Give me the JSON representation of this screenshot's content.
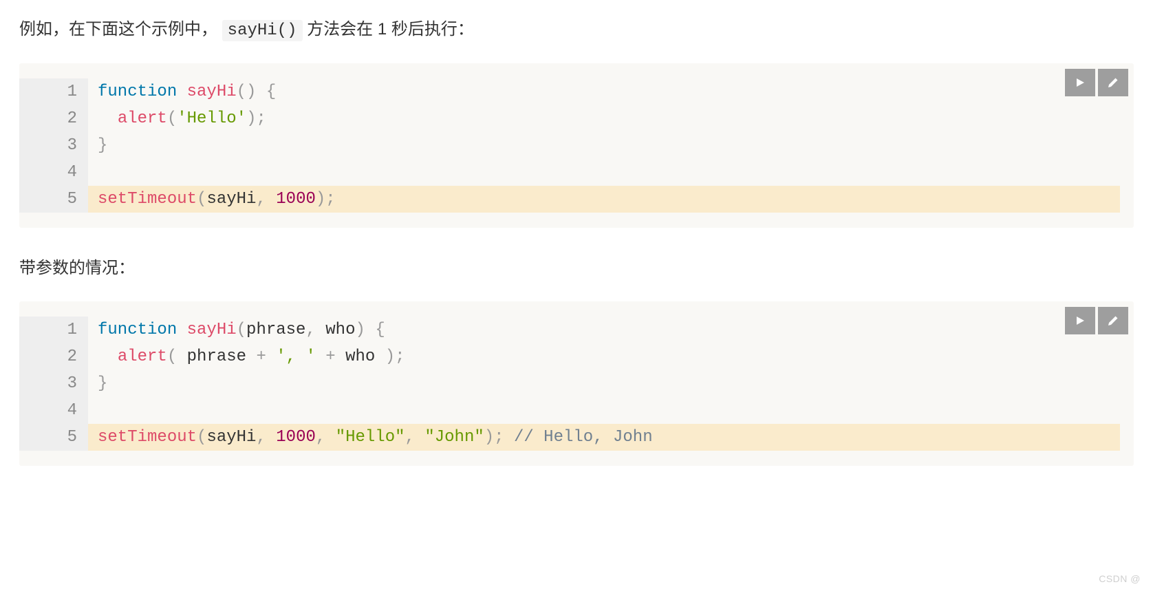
{
  "para1": {
    "pre": "例如，在下面这个示例中，",
    "code": "sayHi()",
    "post": " 方法会在 1 秒后执行："
  },
  "para2": "带参数的情况：",
  "watermark": "CSDN @",
  "code_blocks": [
    {
      "line_numbers": [
        "1",
        "2",
        "3",
        "4",
        "5"
      ],
      "highlighted_lines": [
        5
      ],
      "lines": [
        [
          {
            "cls": "tk-kw",
            "t": "function"
          },
          {
            "cls": "",
            "t": " "
          },
          {
            "cls": "tk-fn",
            "t": "sayHi"
          },
          {
            "cls": "tk-punc",
            "t": "()"
          },
          {
            "cls": "",
            "t": " "
          },
          {
            "cls": "tk-punc",
            "t": "{"
          }
        ],
        [
          {
            "cls": "",
            "t": "  "
          },
          {
            "cls": "tk-fn",
            "t": "alert"
          },
          {
            "cls": "tk-punc",
            "t": "("
          },
          {
            "cls": "tk-str",
            "t": "'Hello'"
          },
          {
            "cls": "tk-punc",
            "t": ")"
          },
          {
            "cls": "tk-punc",
            "t": ";"
          }
        ],
        [
          {
            "cls": "tk-punc",
            "t": "}"
          }
        ],
        [
          {
            "cls": "",
            "t": ""
          }
        ],
        [
          {
            "cls": "tk-fn",
            "t": "setTimeout"
          },
          {
            "cls": "tk-punc",
            "t": "("
          },
          {
            "cls": "",
            "t": "sayHi"
          },
          {
            "cls": "tk-punc",
            "t": ","
          },
          {
            "cls": "",
            "t": " "
          },
          {
            "cls": "tk-num",
            "t": "1000"
          },
          {
            "cls": "tk-punc",
            "t": ")"
          },
          {
            "cls": "tk-punc",
            "t": ";"
          }
        ]
      ]
    },
    {
      "line_numbers": [
        "1",
        "2",
        "3",
        "4",
        "5"
      ],
      "highlighted_lines": [
        5
      ],
      "lines": [
        [
          {
            "cls": "tk-kw",
            "t": "function"
          },
          {
            "cls": "",
            "t": " "
          },
          {
            "cls": "tk-fn",
            "t": "sayHi"
          },
          {
            "cls": "tk-punc",
            "t": "("
          },
          {
            "cls": "tk-param",
            "t": "phrase"
          },
          {
            "cls": "tk-punc",
            "t": ","
          },
          {
            "cls": "",
            "t": " "
          },
          {
            "cls": "tk-param",
            "t": "who"
          },
          {
            "cls": "tk-punc",
            "t": ")"
          },
          {
            "cls": "",
            "t": " "
          },
          {
            "cls": "tk-punc",
            "t": "{"
          }
        ],
        [
          {
            "cls": "",
            "t": "  "
          },
          {
            "cls": "tk-fn",
            "t": "alert"
          },
          {
            "cls": "tk-punc",
            "t": "("
          },
          {
            "cls": "",
            "t": " phrase "
          },
          {
            "cls": "tk-op",
            "t": "+"
          },
          {
            "cls": "",
            "t": " "
          },
          {
            "cls": "tk-str",
            "t": "', '"
          },
          {
            "cls": "",
            "t": " "
          },
          {
            "cls": "tk-op",
            "t": "+"
          },
          {
            "cls": "",
            "t": " who "
          },
          {
            "cls": "tk-punc",
            "t": ")"
          },
          {
            "cls": "tk-punc",
            "t": ";"
          }
        ],
        [
          {
            "cls": "tk-punc",
            "t": "}"
          }
        ],
        [
          {
            "cls": "",
            "t": ""
          }
        ],
        [
          {
            "cls": "tk-fn",
            "t": "setTimeout"
          },
          {
            "cls": "tk-punc",
            "t": "("
          },
          {
            "cls": "",
            "t": "sayHi"
          },
          {
            "cls": "tk-punc",
            "t": ","
          },
          {
            "cls": "",
            "t": " "
          },
          {
            "cls": "tk-num",
            "t": "1000"
          },
          {
            "cls": "tk-punc",
            "t": ","
          },
          {
            "cls": "",
            "t": " "
          },
          {
            "cls": "tk-str",
            "t": "\"Hello\""
          },
          {
            "cls": "tk-punc",
            "t": ","
          },
          {
            "cls": "",
            "t": " "
          },
          {
            "cls": "tk-str",
            "t": "\"John\""
          },
          {
            "cls": "tk-punc",
            "t": ")"
          },
          {
            "cls": "tk-punc",
            "t": ";"
          },
          {
            "cls": "",
            "t": " "
          },
          {
            "cls": "tk-cmt",
            "t": "// Hello, John"
          }
        ]
      ]
    }
  ]
}
